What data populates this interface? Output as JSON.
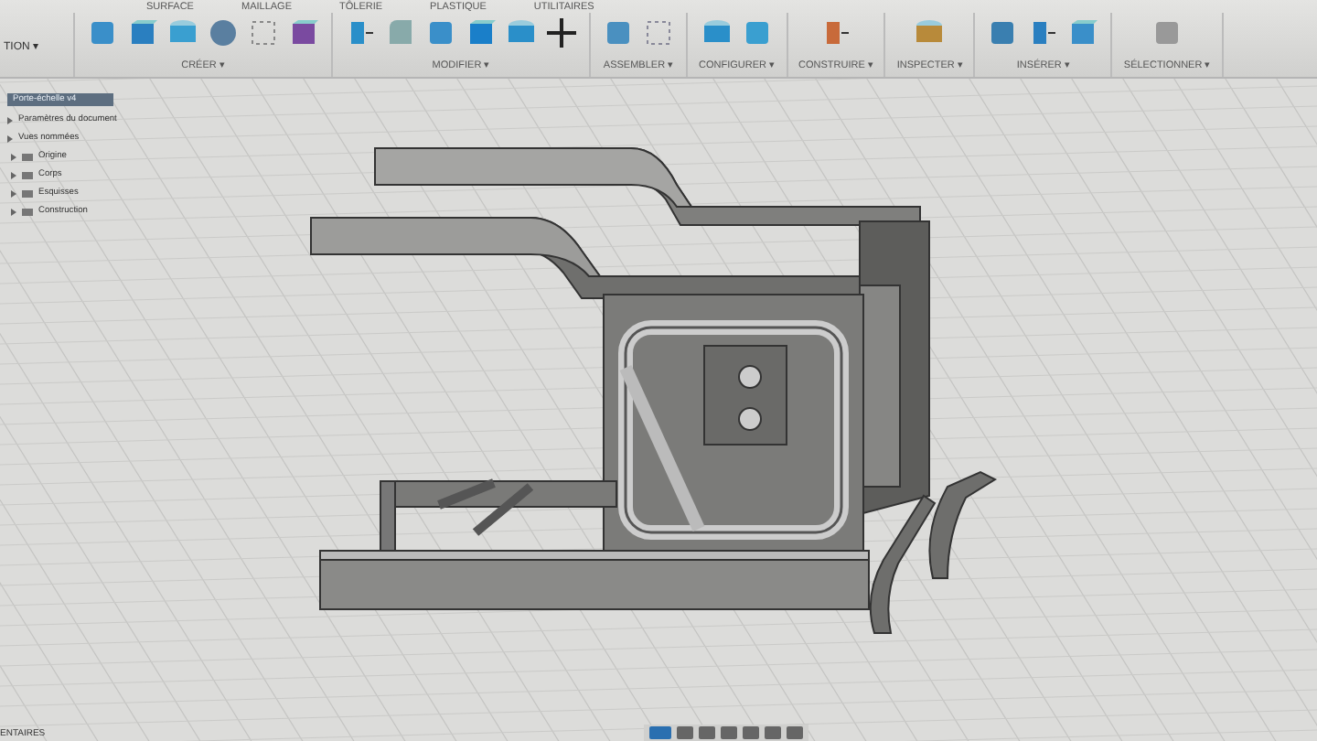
{
  "toolbar": {
    "workspace": "TION ▾",
    "tabs": [
      {
        "label": "SURFACE",
        "selected": false
      },
      {
        "label": "MAILLAGE",
        "selected": false
      },
      {
        "label": "TÔLERIE",
        "selected": false
      },
      {
        "label": "PLASTIQUE",
        "selected": false
      },
      {
        "label": "UTILITAIRES",
        "selected": false
      }
    ],
    "groups": [
      {
        "label": "CRÉER ▾"
      },
      {
        "label": "MODIFIER ▾"
      },
      {
        "label": "ASSEMBLER ▾"
      },
      {
        "label": "CONFIGURER ▾"
      },
      {
        "label": "CONSTRUIRE ▾"
      },
      {
        "label": "INSPECTER ▾"
      },
      {
        "label": "INSÉRER ▾"
      },
      {
        "label": "SÉLECTIONNER ▾"
      }
    ]
  },
  "browser": {
    "title": "Porte-échelle v4",
    "items": [
      {
        "label": "Paramètres du document"
      },
      {
        "label": "Vues nommées"
      },
      {
        "label": "Origine"
      },
      {
        "label": "Corps"
      },
      {
        "label": "Esquisses"
      },
      {
        "label": "Construction"
      }
    ]
  },
  "status_bar": {
    "panel": "ENTAIRES"
  }
}
